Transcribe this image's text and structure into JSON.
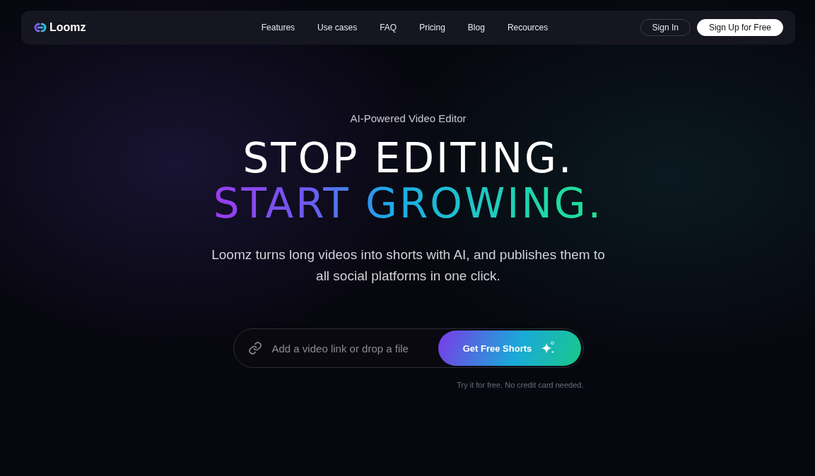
{
  "navbar": {
    "brand": "Loomz",
    "links": [
      "Features",
      "Use cases",
      "FAQ",
      "Pricing",
      "Blog",
      "Recources"
    ],
    "sign_in": "Sign In",
    "sign_up": "Sign Up for Free"
  },
  "hero": {
    "eyebrow": "AI-Powered Video Editor",
    "headline": [
      {
        "text": "STOP EDITING.",
        "kind": "plain"
      },
      {
        "text": "START GROWING.",
        "kind": "gradient"
      }
    ],
    "subtitle": "Loomz turns long videos into shorts with AI, and publishes them to all social platforms in one click.",
    "input": {
      "placeholder": "Add a video link or drop a file"
    },
    "cta": "Get Free Shorts",
    "note": "Try it for free. No credit card needed."
  }
}
